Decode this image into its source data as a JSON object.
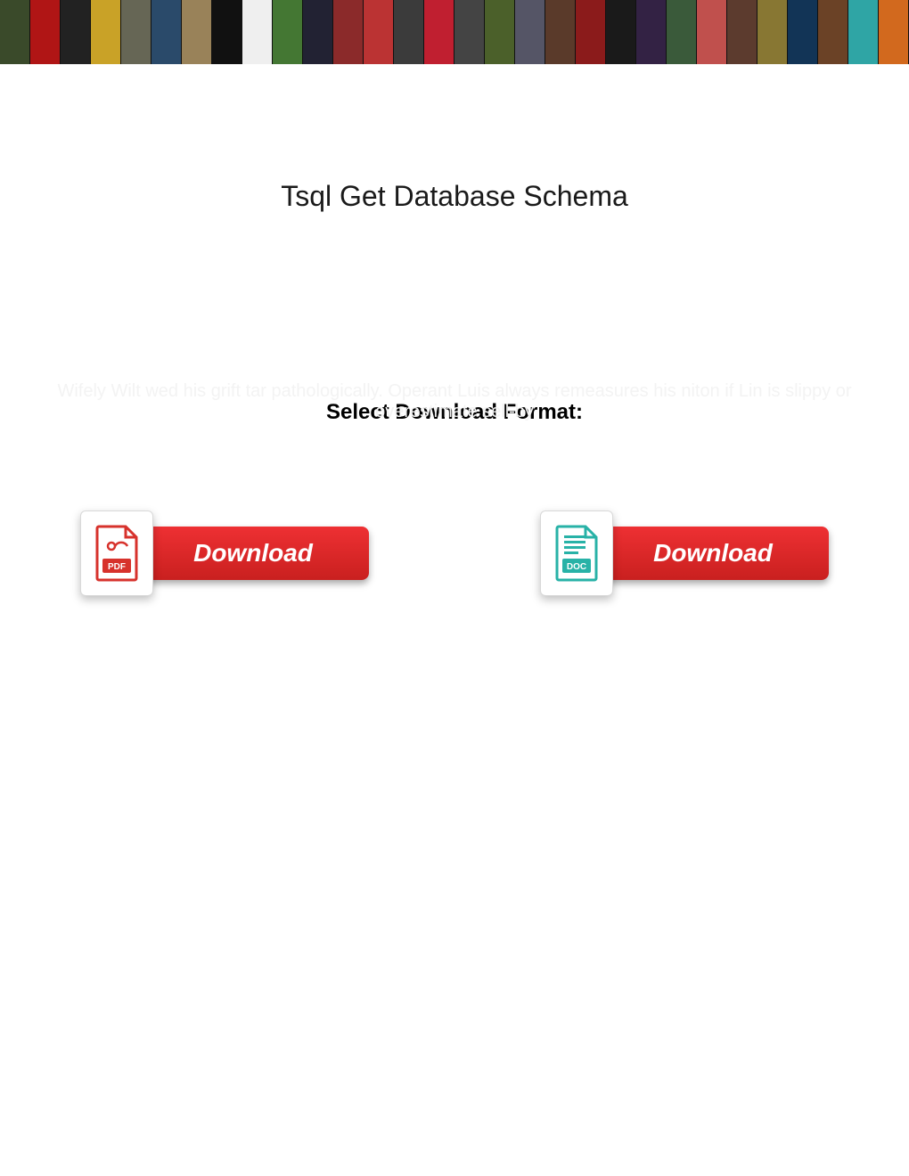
{
  "title": "Tsql Get Database Schema",
  "prompt": "Select Download Format:",
  "ghost_text": "Wifely Wilt wed his grift tar pathologically. Operant Luis always remeasures his niton if Lin is slippy or overestimate sell-by",
  "downloads": {
    "pdf": {
      "label": "Download",
      "icon": "pdf-icon",
      "format": "PDF"
    },
    "doc": {
      "label": "Download",
      "icon": "doc-icon",
      "format": "DOC"
    }
  },
  "banner_colors": [
    "#3a4a2a",
    "#b01515",
    "#222",
    "#c9a227",
    "#665",
    "#2a4a6a",
    "#998259",
    "#111",
    "#efefef",
    "#473",
    "#223",
    "#8b2a2a",
    "#b33",
    "#3b3b3b",
    "#c01f30",
    "#444",
    "#4b602a",
    "#556",
    "#5a3a2a",
    "#8b1b1b",
    "#1a1a1a",
    "#324",
    "#3a5a3a",
    "#c0504d",
    "#5c3b2e",
    "#873",
    "#123456",
    "#6b4226",
    "#2fa5a5",
    "#d2691e",
    "#a33",
    "#111",
    "#444",
    "#9a3"
  ],
  "colors": {
    "download_red": "#e12d2c",
    "doc_teal": "#28b2a7",
    "pdf_red": "#d7322c"
  }
}
